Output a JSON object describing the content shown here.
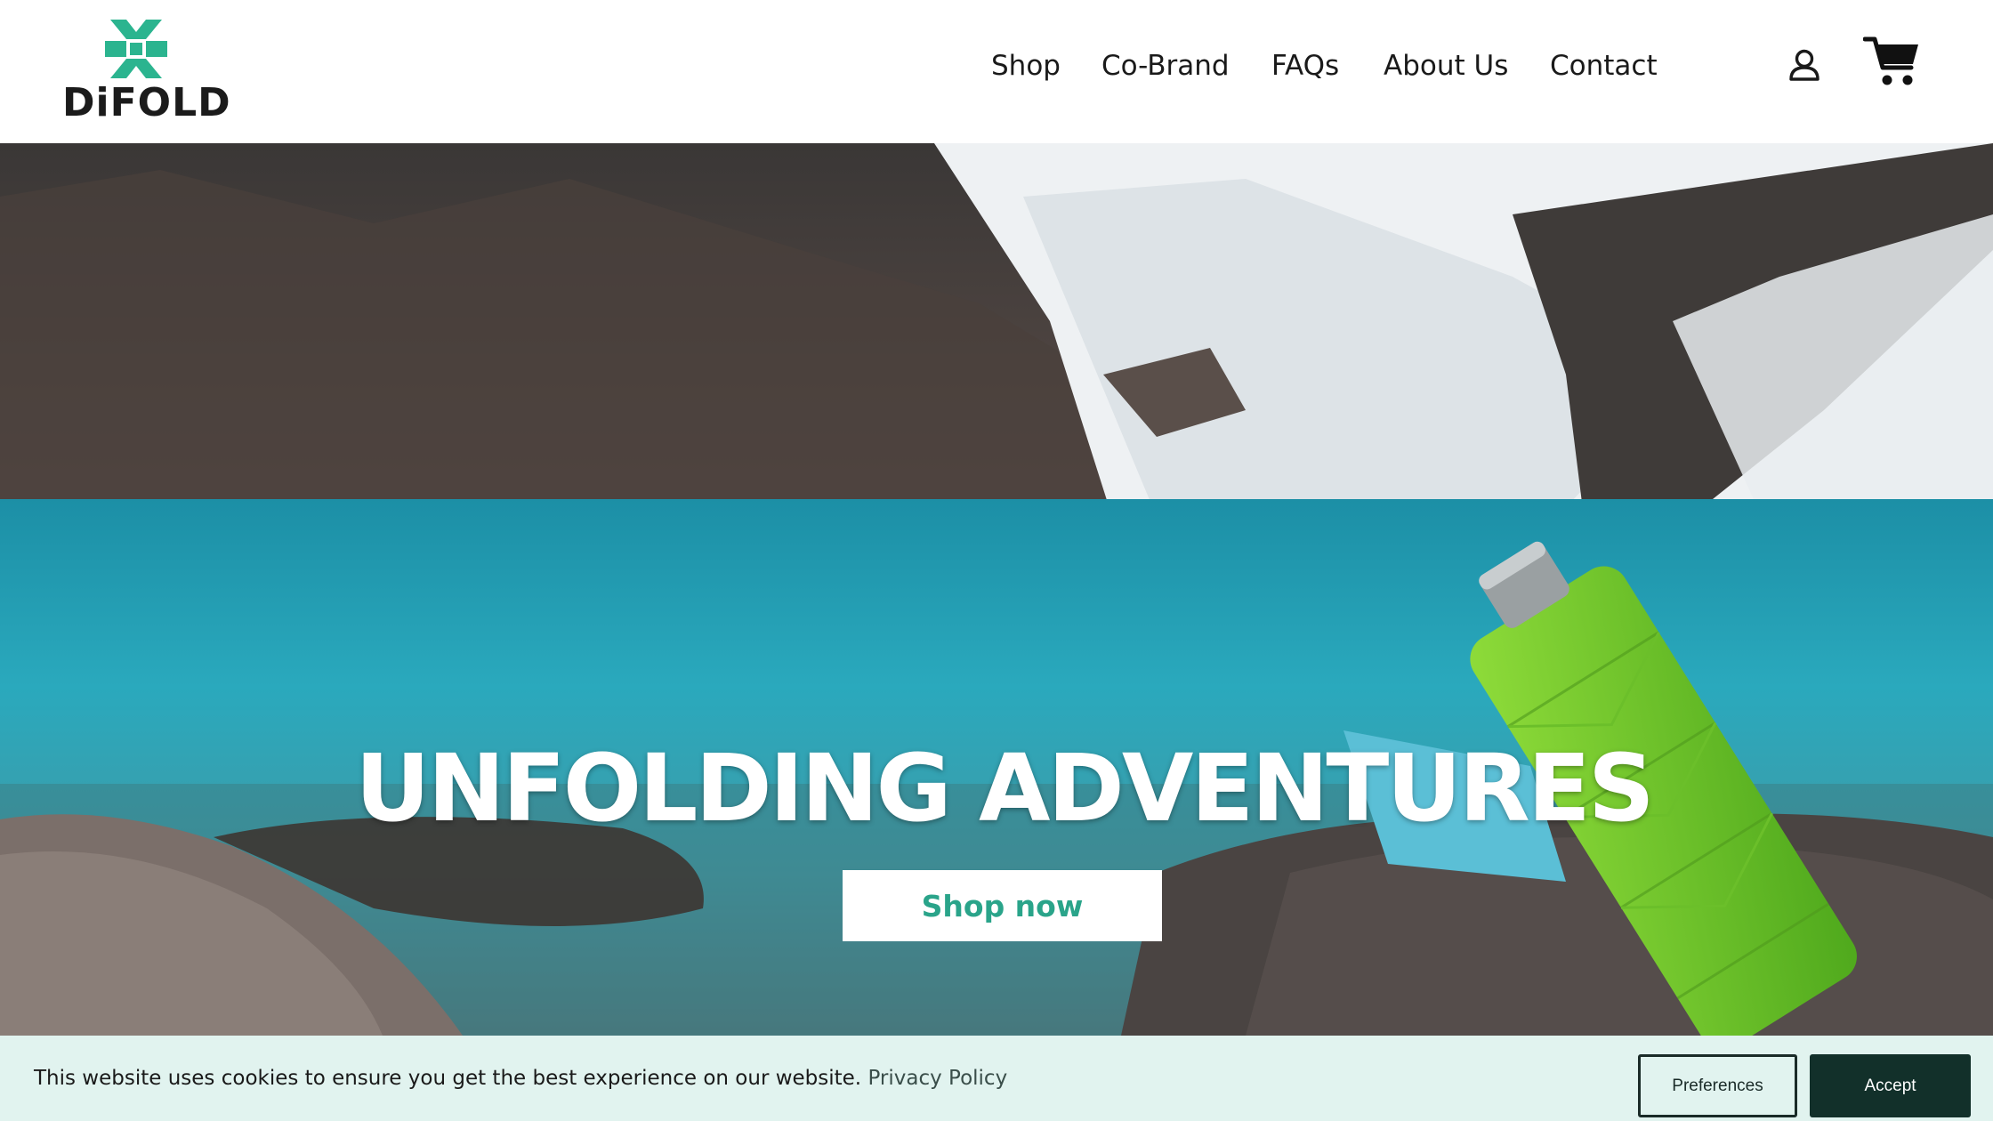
{
  "brand": {
    "name": "DiFOLD",
    "logo_icon": "difold-logo-icon",
    "accent": "#2bb48f"
  },
  "nav": {
    "items": [
      "Shop",
      "Co-Brand",
      "FAQs",
      "About Us",
      "Contact"
    ]
  },
  "header_icons": {
    "account": "user-icon",
    "cart": "cart-icon"
  },
  "hero": {
    "title": "UNFOLDING ADVENTURES",
    "cta_label": "Shop now",
    "cta_color": "#2aa48a"
  },
  "cookie_banner": {
    "message": "This website uses cookies to ensure you get the best experience on our website.",
    "link_label": "Privacy Policy",
    "preferences_label": "Preferences",
    "accept_label": "Accept",
    "background": "#e1f3ef",
    "accept_background": "#12302a"
  }
}
